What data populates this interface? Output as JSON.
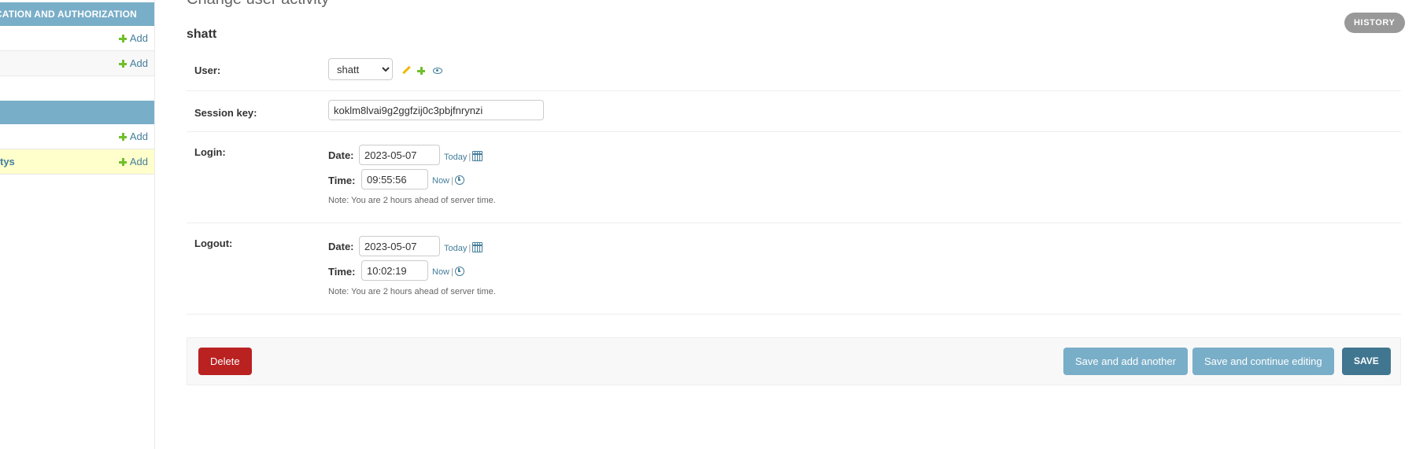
{
  "sidebar": {
    "captions": [
      {
        "label": "CATION AND AUTHORIZATION"
      },
      {
        "label": ""
      }
    ],
    "rows": [
      {
        "model": "",
        "add_label": "Add"
      },
      {
        "model": "",
        "add_label": "Add"
      },
      {
        "model": "",
        "add_label": ""
      },
      {
        "model": "",
        "add_label": "Add"
      },
      {
        "model": "tys",
        "add_label": "Add"
      }
    ]
  },
  "header": {
    "title": "Change user activity",
    "history_label": "HISTORY",
    "object_name": "shatt"
  },
  "form": {
    "user": {
      "label": "User:",
      "selected": "shatt"
    },
    "session_key": {
      "label": "Session key:",
      "value": "koklm8lvai9g2ggfzij0c3pbjfnrynzi"
    },
    "login": {
      "label": "Login:",
      "date_label": "Date:",
      "date_value": "2023-05-07",
      "today_label": "Today",
      "time_label": "Time:",
      "time_value": "09:55:56",
      "now_label": "Now",
      "separator": "|",
      "note": "Note: You are 2 hours ahead of server time."
    },
    "logout": {
      "label": "Logout:",
      "date_label": "Date:",
      "date_value": "2023-05-07",
      "today_label": "Today",
      "time_label": "Time:",
      "time_value": "10:02:19",
      "now_label": "Now",
      "separator": "|",
      "note": "Note: You are 2 hours ahead of server time."
    }
  },
  "actions": {
    "delete_label": "Delete",
    "save_add_another_label": "Save and add another",
    "save_continue_label": "Save and continue editing",
    "save_label": "SAVE"
  },
  "colors": {
    "accent": "#79aec8",
    "link": "#447e9b",
    "add_green": "#70bf2b",
    "delete_red": "#ba2121",
    "save_blue": "#417690"
  }
}
